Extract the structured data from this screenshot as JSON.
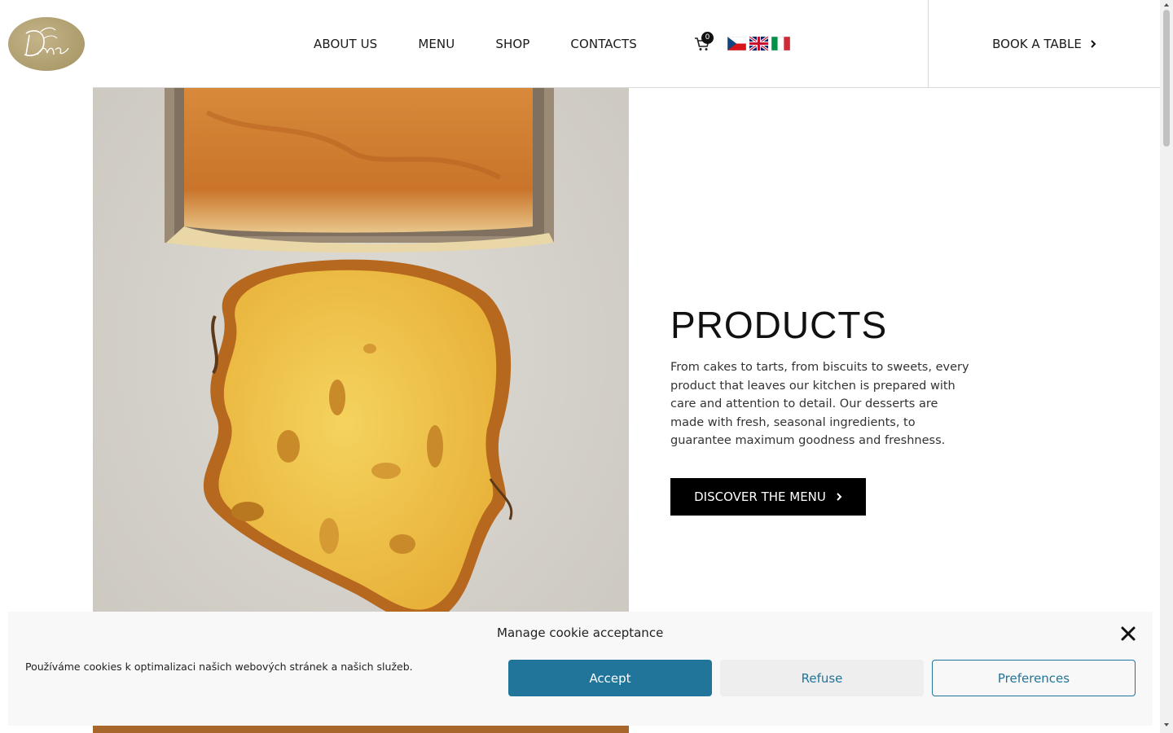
{
  "header": {
    "logo_text": "Dolce Mente",
    "nav": [
      "ABOUT US",
      "MENU",
      "SHOP",
      "CONTACTS"
    ],
    "cart_count": "0",
    "flags": [
      "czech-flag-icon",
      "uk-flag-icon",
      "italian-flag-icon"
    ],
    "book_label": "BOOK A TABLE"
  },
  "products": {
    "title": "PRODUCTS",
    "text": "From cakes to tarts, from biscuits to sweets, every product that leaves our kitchen is prepared with care and attention to detail. Our desserts are made with fresh, seasonal ingredients, to guarantee maximum goodness and freshness.",
    "button_label": "DISCOVER THE MENU"
  },
  "cookie": {
    "title": "Manage cookie acceptance",
    "text": "Používáme cookies k optimalizaci našich webových stránek a našich služeb.",
    "accept_label": "Accept",
    "refuse_label": "Refuse",
    "preferences_label": "Preferences"
  },
  "colors": {
    "accent": "#21759b",
    "logo_gold": "#ad9c6c",
    "button_black": "#000000"
  }
}
